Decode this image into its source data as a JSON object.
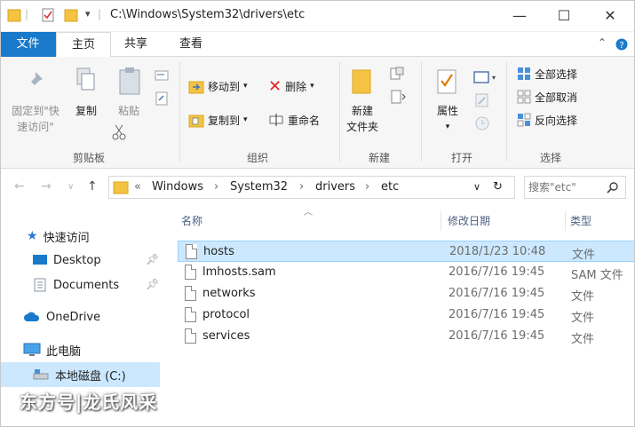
{
  "window": {
    "path": "C:\\Windows\\System32\\drivers\\etc",
    "minimize": "—",
    "maximize": "☐",
    "close": "✕"
  },
  "tabs": {
    "file": "文件",
    "home": "主页",
    "share": "共享",
    "view": "查看"
  },
  "ribbon": {
    "clipboard": {
      "pin_line1": "固定到\"快",
      "pin_line2": "速访问\"",
      "copy": "复制",
      "paste": "粘贴",
      "label": "剪贴板"
    },
    "organize": {
      "move_to": "移动到",
      "copy_to": "复制到",
      "delete": "删除",
      "rename": "重命名",
      "label": "组织"
    },
    "new": {
      "new_folder_line1": "新建",
      "new_folder_line2": "文件夹",
      "label": "新建"
    },
    "open": {
      "properties": "属性",
      "label": "打开"
    },
    "select": {
      "select_all": "全部选择",
      "select_none": "全部取消",
      "invert": "反向选择",
      "label": "选择"
    }
  },
  "address": {
    "crumbs": [
      "«",
      "Windows",
      "›",
      "System32",
      "›",
      "drivers",
      "›",
      "etc"
    ],
    "search_placeholder": "搜索\"etc\""
  },
  "nav_pane": {
    "quick_access": "快速访问",
    "desktop": "Desktop",
    "documents": "Documents",
    "onedrive": "OneDrive",
    "this_pc": "此电脑",
    "local_disk": "本地磁盘 (C:)"
  },
  "columns": {
    "name": "名称",
    "date": "修改日期",
    "type": "类型"
  },
  "files": [
    {
      "name": "hosts",
      "date": "2018/1/23 10:48",
      "type": "文件"
    },
    {
      "name": "lmhosts.sam",
      "date": "2016/7/16 19:45",
      "type": "SAM 文件"
    },
    {
      "name": "networks",
      "date": "2016/7/16 19:45",
      "type": "文件"
    },
    {
      "name": "protocol",
      "date": "2016/7/16 19:45",
      "type": "文件"
    },
    {
      "name": "services",
      "date": "2016/7/16 19:45",
      "type": "文件"
    }
  ],
  "watermark": "东方号|龙氏风采",
  "colors": {
    "accent": "#1979ca",
    "selection": "#cce8ff",
    "folder": "#f5c342"
  }
}
